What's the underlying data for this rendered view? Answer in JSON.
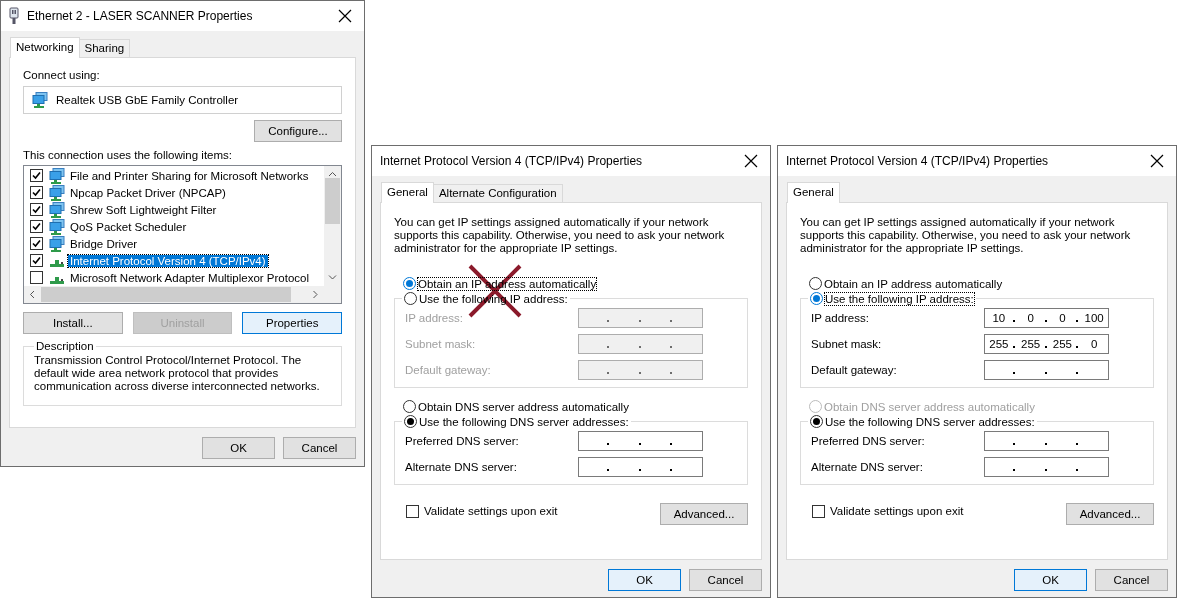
{
  "windows": [
    {
      "kind": "adapter",
      "title": "Ethernet 2 - LASER SCANNER Properties",
      "tabs": [
        {
          "label": "Networking",
          "selected": true
        },
        {
          "label": "Sharing",
          "selected": false
        }
      ],
      "connect_label": "Connect using:",
      "adapter": "Realtek USB GbE Family Controller",
      "configure_button": "Configure...",
      "items_label": "This connection uses the following items:",
      "items": [
        {
          "label": "File and Printer Sharing for Microsoft Networks",
          "kind": "service",
          "checked": true,
          "selected": false
        },
        {
          "label": "Npcap Packet Driver (NPCAP)",
          "kind": "service",
          "checked": true,
          "selected": false
        },
        {
          "label": "Shrew Soft Lightweight Filter",
          "kind": "service",
          "checked": true,
          "selected": false
        },
        {
          "label": "QoS Packet Scheduler",
          "kind": "service",
          "checked": true,
          "selected": false
        },
        {
          "label": "Bridge Driver",
          "kind": "service",
          "checked": true,
          "selected": false
        },
        {
          "label": "Internet Protocol Version 4 (TCP/IPv4)",
          "kind": "protocol",
          "checked": true,
          "selected": true
        },
        {
          "label": "Microsoft Network Adapter Multiplexor Protocol",
          "kind": "protocol",
          "checked": false,
          "selected": false
        }
      ],
      "buttons": [
        {
          "label": "Install...",
          "disabled": false,
          "default": false
        },
        {
          "label": "Uninstall",
          "disabled": true,
          "default": false
        },
        {
          "label": "Properties",
          "disabled": false,
          "default": true
        }
      ],
      "description": {
        "title": "Description",
        "text": "Transmission Control Protocol/Internet Protocol. The default wide area network protocol that provides communication across diverse interconnected networks."
      },
      "footer_buttons": [
        {
          "label": "OK",
          "default": false
        },
        {
          "label": "Cancel",
          "default": false
        }
      ]
    },
    {
      "kind": "ipv4",
      "title": "Internet Protocol Version 4 (TCP/IPv4) Properties",
      "crossed_out": true,
      "tabs": [
        {
          "label": "General",
          "selected": true
        },
        {
          "label": "Alternate Configuration",
          "selected": false
        }
      ],
      "intro": "You can get IP settings assigned automatically if your network supports this capability. Otherwise, you need to ask your network administrator for the appropriate IP settings.",
      "ip_options": [
        {
          "label": "Obtain an IP address automatically",
          "selected": true,
          "focused": true,
          "disabled": false
        },
        {
          "label": "Use the following IP address:",
          "selected": false,
          "focused": false,
          "disabled": false
        }
      ],
      "ip_fields": [
        {
          "label": "IP address:",
          "disabled": true
        },
        {
          "label": "Subnet mask:",
          "disabled": true
        },
        {
          "label": "Default gateway:",
          "disabled": true
        }
      ],
      "dns_options": [
        {
          "label": "Obtain DNS server address automatically",
          "selected": false,
          "focused": false,
          "disabled": false
        },
        {
          "label": "Use the following DNS server addresses:",
          "selected": true,
          "focused": false,
          "disabled": false
        }
      ],
      "dns_fields": [
        {
          "label": "Preferred DNS server:",
          "disabled": false
        },
        {
          "label": "Alternate DNS server:",
          "disabled": false
        }
      ],
      "validate": {
        "label": "Validate settings upon exit",
        "checked": false
      },
      "advanced_button": "Advanced...",
      "footer_buttons": [
        {
          "label": "OK",
          "default": true
        },
        {
          "label": "Cancel",
          "default": false
        }
      ]
    },
    {
      "kind": "ipv4",
      "title": "Internet Protocol Version 4 (TCP/IPv4) Properties",
      "crossed_out": false,
      "tabs": [
        {
          "label": "General",
          "selected": true
        }
      ],
      "intro": "You can get IP settings assigned automatically if your network supports this capability. Otherwise, you need to ask your network administrator for the appropriate IP settings.",
      "ip_options": [
        {
          "label": "Obtain an IP address automatically",
          "selected": false,
          "focused": false,
          "disabled": false
        },
        {
          "label": "Use the following IP address:",
          "selected": true,
          "focused": true,
          "disabled": false
        }
      ],
      "ip_fields": [
        {
          "label": "IP address:",
          "disabled": false,
          "octets": [
            "10",
            "0",
            "0",
            "100"
          ]
        },
        {
          "label": "Subnet mask:",
          "disabled": false,
          "octets": [
            "255",
            "255",
            "255",
            "0"
          ]
        },
        {
          "label": "Default gateway:",
          "disabled": false
        }
      ],
      "dns_options": [
        {
          "label": "Obtain DNS server address automatically",
          "selected": false,
          "focused": false,
          "disabled": true
        },
        {
          "label": "Use the following DNS server addresses:",
          "selected": true,
          "focused": false,
          "disabled": false
        }
      ],
      "dns_fields": [
        {
          "label": "Preferred DNS server:",
          "disabled": false
        },
        {
          "label": "Alternate DNS server:",
          "disabled": false
        }
      ],
      "validate": {
        "label": "Validate settings upon exit",
        "checked": false
      },
      "advanced_button": "Advanced...",
      "footer_buttons": [
        {
          "label": "OK",
          "default": true
        },
        {
          "label": "Cancel",
          "default": false
        }
      ]
    }
  ]
}
